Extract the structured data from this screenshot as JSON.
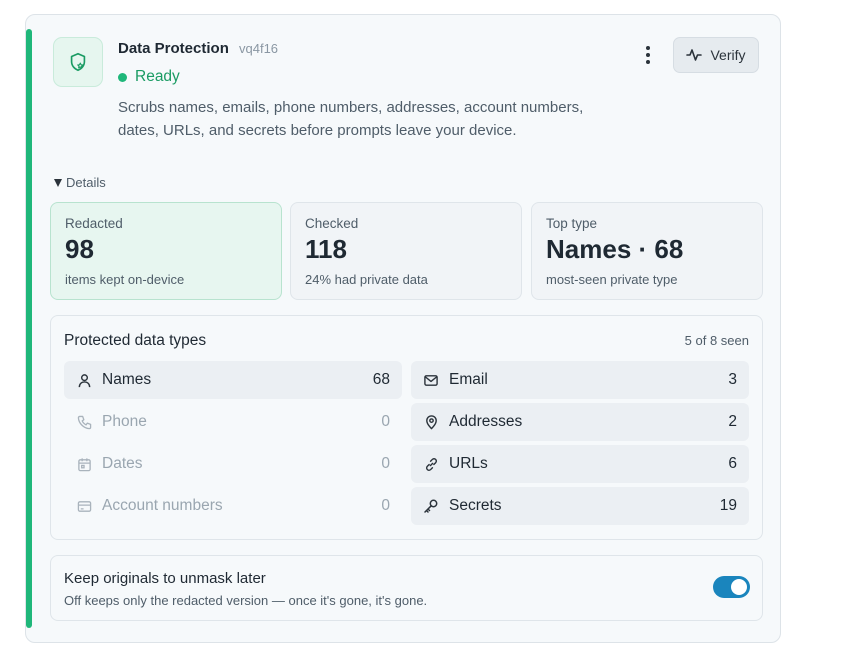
{
  "header": {
    "title": "Data Protection",
    "id": "vq4f16",
    "status": "Ready",
    "description": "Scrubs names, emails, phone numbers, addresses, account numbers, dates, URLs, and secrets before prompts leave your device.",
    "verify_label": "Verify",
    "accent_color": "#1fb77a"
  },
  "details": {
    "label": "Details"
  },
  "stats": [
    {
      "label": "Redacted",
      "value": "98",
      "sub": "items kept on-device"
    },
    {
      "label": "Checked",
      "value": "118",
      "sub": "24% had private data"
    },
    {
      "label": "Top type",
      "value": "Names · 68",
      "sub": "most-seen private type"
    }
  ],
  "types": {
    "title": "Protected data types",
    "seen": "5 of 8 seen",
    "left": [
      {
        "icon": "person-icon",
        "label": "Names",
        "count": "68",
        "active": true
      },
      {
        "icon": "phone-icon",
        "label": "Phone",
        "count": "0",
        "active": false
      },
      {
        "icon": "calendar-icon",
        "label": "Dates",
        "count": "0",
        "active": false
      },
      {
        "icon": "card-icon",
        "label": "Account numbers",
        "count": "0",
        "active": false
      }
    ],
    "right": [
      {
        "icon": "mail-icon",
        "label": "Email",
        "count": "3",
        "active": true
      },
      {
        "icon": "pin-icon",
        "label": "Addresses",
        "count": "2",
        "active": true
      },
      {
        "icon": "link-icon",
        "label": "URLs",
        "count": "6",
        "active": true
      },
      {
        "icon": "key-icon",
        "label": "Secrets",
        "count": "19",
        "active": true
      }
    ]
  },
  "keep_originals": {
    "title": "Keep originals to unmask later",
    "sub": "Off keeps only the redacted version — once it's gone, it's gone.",
    "enabled": true,
    "toggle_color": "#1a85bd"
  }
}
